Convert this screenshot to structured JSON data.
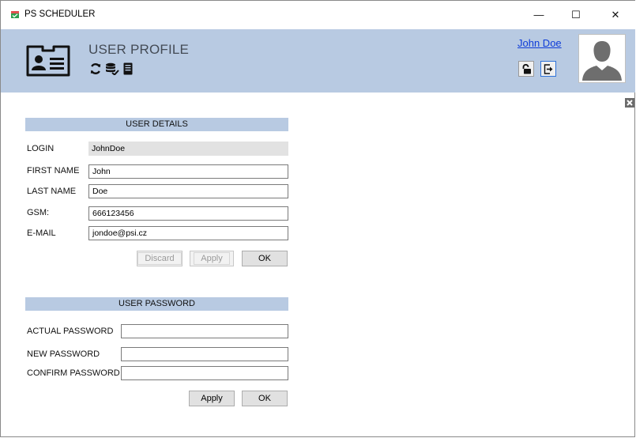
{
  "window": {
    "title": "PS SCHEDULER",
    "controls": {
      "minimize": "—",
      "maximize": "☐",
      "close": "✕"
    }
  },
  "header": {
    "title": "USER PROFILE",
    "user_name": "John Doe",
    "tools": [
      "refresh-icon",
      "database-icon",
      "server-icon"
    ],
    "accent": "#b8cae2"
  },
  "user_details": {
    "heading": "USER DETAILS",
    "login_label": "LOGIN",
    "login_value": "JohnDoe",
    "first_name_label": "FIRST NAME",
    "first_name_value": "John",
    "last_name_label": "LAST NAME",
    "last_name_value": "Doe",
    "gsm_label": "GSM:",
    "gsm_value": "666123456",
    "email_label": "E-MAIL",
    "email_value": "jondoe@psi.cz",
    "discard_label": "Discard",
    "apply_label": "Apply",
    "ok_label": "OK"
  },
  "user_password": {
    "heading": "USER PASSWORD",
    "actual_label": "ACTUAL PASSWORD",
    "new_label": "NEW PASSWORD",
    "confirm_label": "CONFIRM PASSWORD",
    "apply_label": "Apply",
    "ok_label": "OK"
  }
}
